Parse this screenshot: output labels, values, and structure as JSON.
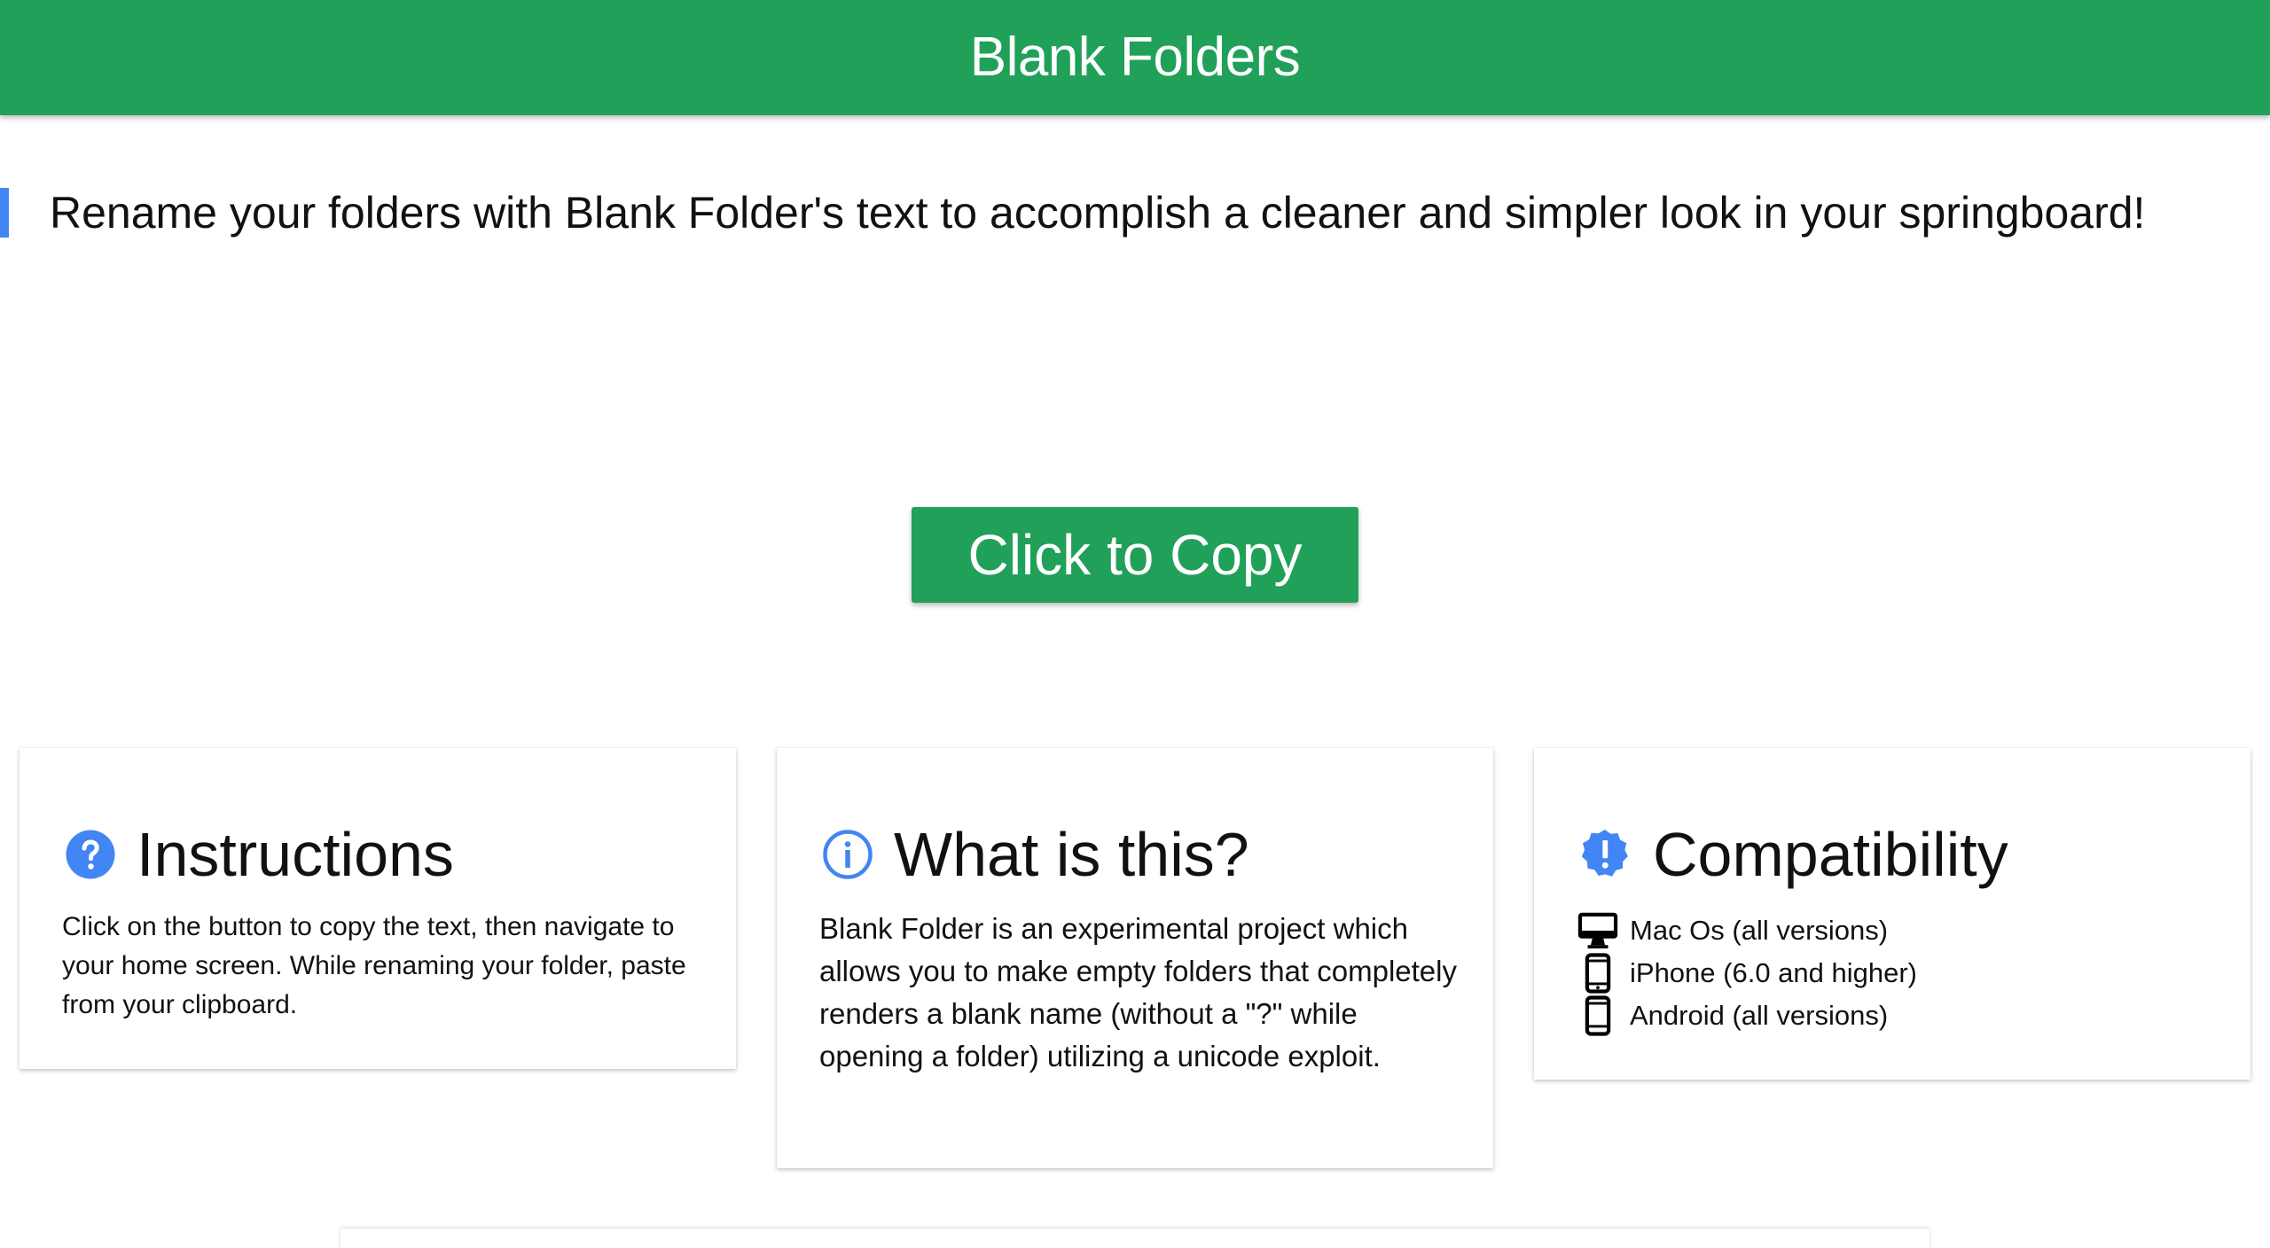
{
  "header": {
    "title": "Blank Folders"
  },
  "tagline": "Rename your folders with Blank Folder's text to accomplish a cleaner and simpler look in your springboard!",
  "copy_button": {
    "label": "Click to Copy"
  },
  "cards": {
    "instructions": {
      "icon": "help-circle-icon",
      "title": "Instructions",
      "body": "Click on the button to copy the text, then navigate to your home screen. While renaming your folder, paste from your clipboard."
    },
    "what_is_this": {
      "icon": "info-icon",
      "title": "What is this?",
      "body": "Blank Folder is an experimental project which allows you to make empty folders that completely renders a blank name (without a \"?\" while opening a folder) utilizing a unicode exploit."
    },
    "compatibility": {
      "icon": "verified-badge-icon",
      "title": "Compatibility",
      "items": [
        {
          "icon": "desktop-icon",
          "label": "Mac Os (all versions)"
        },
        {
          "icon": "phone-icon",
          "label": "iPhone (6.0 and higher)"
        },
        {
          "icon": "phone-icon",
          "label": "Android (all versions)"
        }
      ]
    }
  },
  "colors": {
    "brand_green": "#21a05a",
    "accent_blue": "#4285f4",
    "text": "#111111"
  }
}
